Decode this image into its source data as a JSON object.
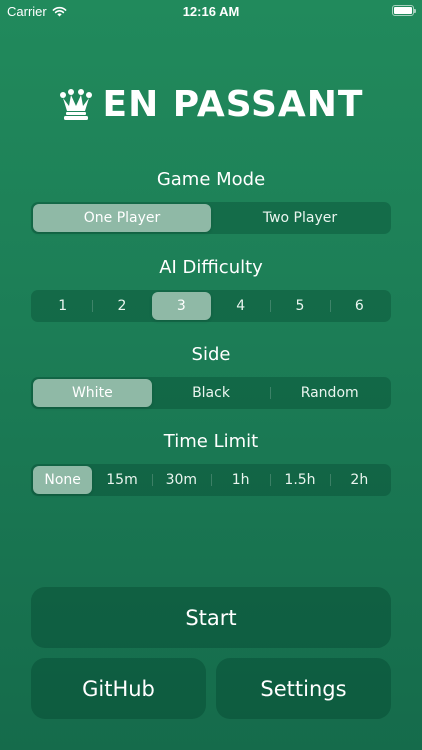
{
  "status_bar": {
    "carrier": "Carrier",
    "time": "12:16 AM",
    "wifi_icon": "wifi-icon",
    "battery_icon": "battery-icon"
  },
  "header": {
    "title": "EN PASSANT",
    "icon": "queen-crown-icon"
  },
  "game_mode": {
    "label": "Game Mode",
    "options": [
      "One Player",
      "Two Player"
    ],
    "selected": "One Player"
  },
  "ai_difficulty": {
    "label": "AI Difficulty",
    "options": [
      "1",
      "2",
      "3",
      "4",
      "5",
      "6"
    ],
    "selected": "3"
  },
  "side": {
    "label": "Side",
    "options": [
      "White",
      "Black",
      "Random"
    ],
    "selected": "White"
  },
  "time_limit": {
    "label": "Time Limit",
    "options": [
      "None",
      "15m",
      "30m",
      "1h",
      "1.5h",
      "2h"
    ],
    "selected": "None"
  },
  "actions": {
    "start": "Start",
    "github": "GitHub",
    "settings": "Settings"
  },
  "colors": {
    "background_top": "#218a5c",
    "background_bottom": "#156b4b",
    "selected_segment": "#8fb9a6"
  }
}
